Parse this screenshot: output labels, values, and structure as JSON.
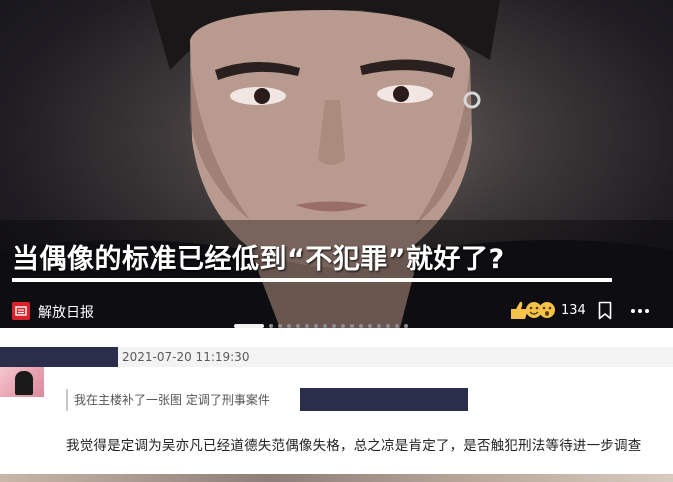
{
  "article": {
    "headline": "当偶像的标准已经低到“不犯罪”就好了?",
    "source_name": "解放日报",
    "like_count": "134",
    "icons": {
      "source_logo": "newspaper-logo-icon",
      "reactions": "emoji-reactions-icon",
      "bookmark": "bookmark-icon",
      "more": "more-dots-icon"
    },
    "carousel": {
      "total_dots": 17,
      "active_index": 0
    }
  },
  "comment": {
    "timestamp": "2021-07-20 11:19:30",
    "quote": "我在主楼补了一张图 定调了刑事案件",
    "body": "我觉得是定调为吴亦凡已经道德失范偶像失格，总之凉是肯定了，是否触犯刑法等待进一步调查"
  },
  "colors": {
    "redaction": "#2b2e4a",
    "source_logo": "#d8232a",
    "comment_header_bg": "#f3f3f3"
  }
}
